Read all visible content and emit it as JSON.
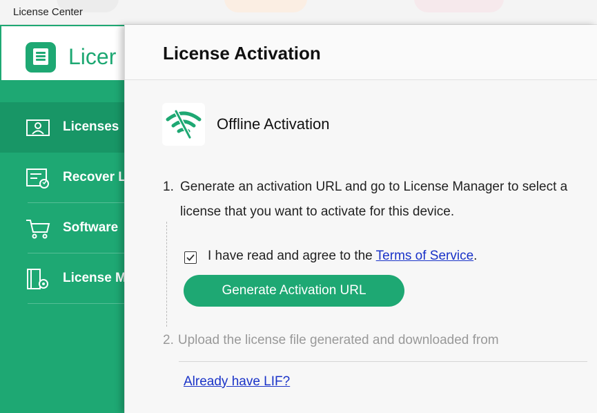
{
  "window": {
    "title": "License Center"
  },
  "brand": {
    "text": "Licer",
    "icon": "license-app-icon"
  },
  "sidebar": {
    "items": [
      {
        "label": "Licenses",
        "icon": "id-card-icon",
        "active": true
      },
      {
        "label": "Recover L",
        "icon": "recover-icon",
        "active": false
      },
      {
        "label": "Software",
        "icon": "cart-icon",
        "active": false
      },
      {
        "label": "License M",
        "icon": "license-settings-icon",
        "active": false
      }
    ]
  },
  "panel": {
    "title": "License Activation",
    "activation": {
      "title": "Offline Activation",
      "icon": "wifi-off-icon"
    },
    "step1": {
      "number": "1.",
      "text": "Generate an activation URL and go to License Manager to select a license that you want to activate for this device."
    },
    "agree": {
      "checked": true,
      "text": "I have read and agree to the ",
      "link": "Terms of Service",
      "suffix": "."
    },
    "generate_button": "Generate Activation URL",
    "step2": {
      "number": "2.",
      "text": "Upload the license file generated and downloaded from"
    },
    "lif_link": "Already have LIF?"
  },
  "colors": {
    "accent": "#1ea873",
    "link": "#1a33c8"
  }
}
